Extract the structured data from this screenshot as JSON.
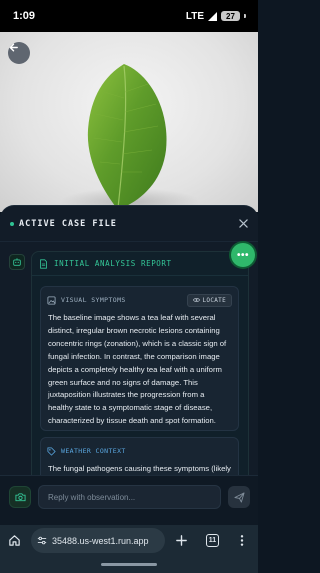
{
  "status_bar": {
    "time": "1:09",
    "network": "LTE",
    "battery": "27"
  },
  "hero": {
    "icon_back": "arrow-left-icon"
  },
  "sheet": {
    "title": "ACTIVE CASE FILE",
    "close_icon": "close-icon",
    "live_color": "#2fc394"
  },
  "fab": {
    "label": "•••",
    "color": "#2fb86b"
  },
  "report": {
    "title": "INITIAL ANALYSIS REPORT",
    "icon": "document-icon",
    "visual": {
      "label": "VISUAL SYMPTOMS",
      "icon": "image-icon",
      "locate_label": "LOCATE",
      "locate_icon": "eye-icon",
      "body": "The baseline image shows a tea leaf with several distinct, irregular brown necrotic lesions containing concentric rings (zonation), which is a classic sign of fungal infection. In contrast, the comparison image depicts a completely healthy tea leaf with a uniform green surface and no signs of damage. This juxtaposition illustrates the progression from a healthy state to a symptomatic stage of disease, characterized by tissue death and spot formation."
    },
    "weather": {
      "label": "WEATHER CONTEXT",
      "icon": "tag-icon",
      "body": "The fungal pathogens causing these symptoms (likely Pestalotiopsis or Colletotrichum) thrive in warm,"
    }
  },
  "reply": {
    "placeholder": "Reply with observation...",
    "camera_icon": "camera-icon",
    "send_icon": "send-icon"
  },
  "browser": {
    "url": "35488.us-west1.run.app",
    "tab_count": "11",
    "home_icon": "home-icon",
    "new_tab_icon": "plus-icon",
    "menu_icon": "more-vertical-icon"
  }
}
